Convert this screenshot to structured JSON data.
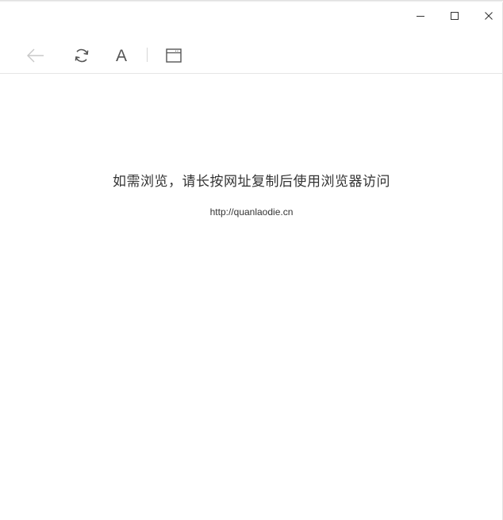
{
  "window": {
    "controls": {
      "minimize_icon": "minimize-icon",
      "maximize_icon": "maximize-icon",
      "close_icon": "close-icon"
    }
  },
  "toolbar": {
    "icons": [
      "back-arrow-icon",
      "refresh-icon",
      "font-size-icon",
      "window-icon"
    ],
    "font_size_glyph": "A",
    "back_enabled": false
  },
  "content": {
    "message": "如需浏览，请长按网址复制后使用浏览器访问",
    "url": "http://quanlaodie.cn"
  },
  "colors": {
    "icon_active": "#555555",
    "icon_disabled": "#c8c8c8",
    "divider": "#e6e6e6",
    "text": "#333333",
    "background": "#ffffff"
  }
}
